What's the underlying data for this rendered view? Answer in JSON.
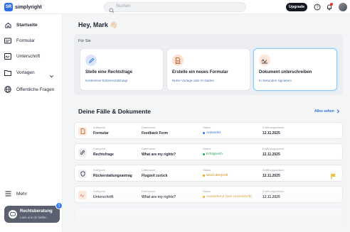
{
  "app": {
    "logo_badge": "SR",
    "name": "simplyright"
  },
  "search": {
    "placeholder": "Suchen"
  },
  "topbar": {
    "upgrade_label": "Upgrade"
  },
  "sidebar": {
    "items": [
      {
        "label": "Startseite",
        "icon": "home-icon",
        "active": true
      },
      {
        "label": "Formular",
        "icon": "form-icon"
      },
      {
        "label": "Unterschrift",
        "icon": "signature-icon"
      },
      {
        "label": "Vorlagen",
        "icon": "folder-icon"
      },
      {
        "label": "Öffentliche Fragen",
        "icon": "public-questions-icon"
      }
    ],
    "more_label": "Mehr",
    "help": {
      "title": "Rechtsberatung",
      "subtitle": "Lass uns dir helfen",
      "badge": "1"
    }
  },
  "main": {
    "greeting": "Hey, Mark 👋🏻",
    "for_you_label": "Für Sie",
    "cards": [
      {
        "title": "Stelle eine Rechtsfrage",
        "subtitle": "Kostenlose Ersteinschätzung!",
        "icon": "pen-icon",
        "color": "#dbe6fb"
      },
      {
        "title": "Erstelle ein neues Formular",
        "subtitle": "Nutze Vorlage oder KI starten",
        "icon": "document-icon",
        "color": "#fde0cf"
      },
      {
        "title": "Dokument unterschreiben",
        "subtitle": "In Sekunden signieren!",
        "icon": "signature-icon",
        "color": "#fde6da"
      }
    ],
    "section_title": "Deine Fälle & Dokumente",
    "see_all": "Alles sehen"
  },
  "table": {
    "headers": {
      "category": "Kategorie",
      "name": "Dateiname",
      "status": "Status",
      "date": "Eröffnungsdatum"
    },
    "rows": [
      {
        "category": "Formular",
        "name": "Feedback Form",
        "status": "Antwortet",
        "status_color": "#2f6fe4",
        "date": "12.11.2025",
        "icon": "document-icon",
        "icon_bg": "#fde6da"
      },
      {
        "category": "Rechtsfrage",
        "name": "What are my rights?",
        "status": "Erfolgreich",
        "status_color": "#22a35a",
        "date": "12.11.2025",
        "icon": "link-icon",
        "icon_bg": "#eef0f3"
      },
      {
        "category": "Rückerstattungsantrag",
        "name": "Flugzeit zurück",
        "status": "Wird überprüft",
        "status_color": "#e3a008",
        "date": "12.11.2025",
        "icon": "shield-icon",
        "icon_bg": "#eef0f3",
        "flag": true
      },
      {
        "category": "Unterschrift",
        "name": "What are my rights?",
        "status": "Ausstehend (Seit Unterschrift)",
        "status_color": "#e3a008",
        "date": "12.11.2025",
        "icon": "signature-icon",
        "icon_bg": "#fde6da"
      }
    ]
  }
}
